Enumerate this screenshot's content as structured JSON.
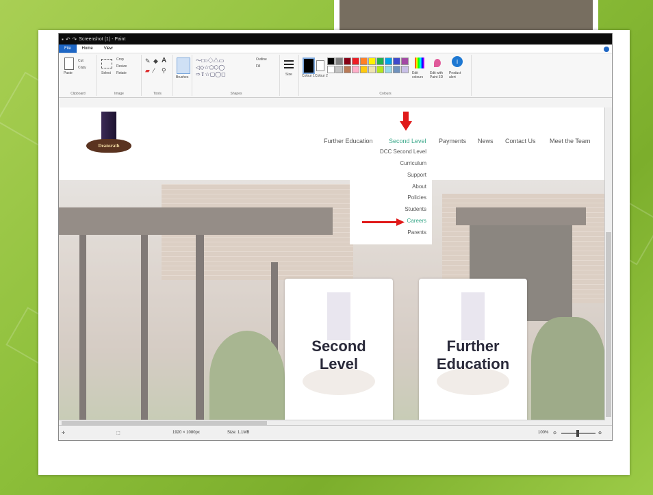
{
  "paint": {
    "window_title": "Screenshot (1) - Paint",
    "tabs": [
      "File",
      "Home",
      "View"
    ],
    "groups": [
      "Clipboard",
      "Image",
      "Tools",
      "Shapes",
      "Colours"
    ],
    "clipboard": {
      "paste": "Paste",
      "cut": "Cut",
      "copy": "Copy"
    },
    "image": {
      "select": "Select",
      "crop": "Crop",
      "resize": "Resize",
      "rotate": "Rotate"
    },
    "tools_brushes": "Brushes",
    "shapes": {
      "outline": "Outline",
      "fill": "Fill"
    },
    "size": "Size",
    "colour1": "Colour 1",
    "colour2": "Colour 2",
    "edit_colours": "Edit colours",
    "edit_paint3d": "Edit with Paint 3D",
    "product_alert": "Product alert",
    "status": {
      "dimensions": "1920 × 1080px",
      "filesize": "Size: 1.1MB",
      "zoom": "100%"
    },
    "swatches": [
      "#000000",
      "#7f7f7f",
      "#880015",
      "#ed1c24",
      "#ff7f27",
      "#fff200",
      "#22b14c",
      "#00a2e8",
      "#3f48cc",
      "#a349a4",
      "#ffffff",
      "#c3c3c3",
      "#b97a57",
      "#ffaec9",
      "#ffc90e",
      "#efe4b0",
      "#b5e61d",
      "#99d9ea",
      "#7092be",
      "#c8bfe7"
    ]
  },
  "site": {
    "nav": [
      "Further Education",
      "Second Level",
      "Payments",
      "News",
      "Contact Us",
      "Meet the Team"
    ],
    "active_nav": "Second Level",
    "dropdown": [
      "DCC Second Level",
      "Curriculum",
      "Support",
      "About",
      "Policies",
      "Students",
      "Careers",
      "Parents"
    ],
    "highlighted_item": "Careers",
    "logo_text": "Deansrath",
    "cards": [
      {
        "line1": "Second",
        "line2": "Level"
      },
      {
        "line1": "Further",
        "line2": "Education"
      }
    ]
  },
  "colors": {
    "accent": "#3aa88a",
    "arrow": "#e01a1a",
    "slide_bg": "#8dbf3a",
    "logo": "#2a1f3d"
  }
}
